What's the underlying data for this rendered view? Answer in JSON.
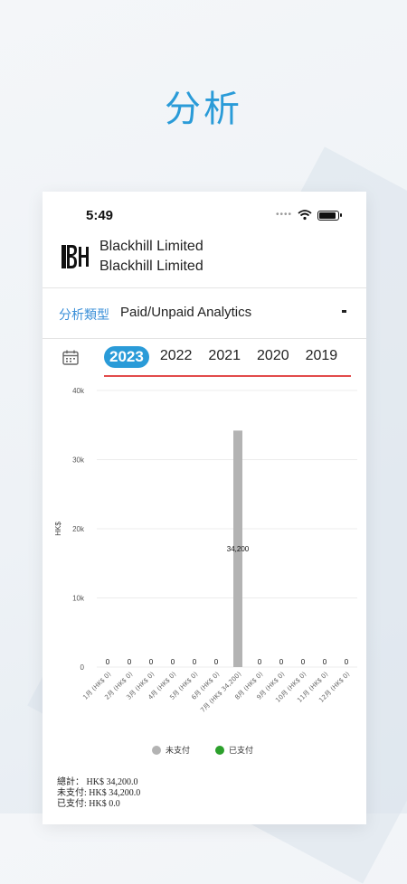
{
  "page": {
    "title": "分析"
  },
  "status_bar": {
    "time": "5:49"
  },
  "company": {
    "name_line1": "Blackhill Limited",
    "name_line2": "Blackhill Limited"
  },
  "analysis": {
    "label": "分析類型",
    "value": "Paid/Unpaid Analytics"
  },
  "years": [
    "2023",
    "2022",
    "2021",
    "2020",
    "2019"
  ],
  "active_year": "2023",
  "colors": {
    "accent": "#2a9bd8",
    "unpaid": "#b3b3b3",
    "paid": "#2ca02c",
    "year_underline": "#e24b4b"
  },
  "chart_data": {
    "type": "bar",
    "ylabel": "HK$",
    "ylim": [
      0,
      40000
    ],
    "yticks": [
      "0",
      "10k",
      "20k",
      "30k",
      "40k"
    ],
    "ytick_values": [
      0,
      10000,
      20000,
      30000,
      40000
    ],
    "categories": [
      "1月 (HK$ 0)",
      "2月 (HK$ 0)",
      "3月 (HK$ 0)",
      "4月 (HK$ 0)",
      "5月 (HK$ 0)",
      "6月 (HK$ 0)",
      "7月 (HK$ 34,200)",
      "8月 (HK$ 0)",
      "9月 (HK$ 0)",
      "10月 (HK$ 0)",
      "11月 (HK$ 0)",
      "12月 (HK$ 0)"
    ],
    "series": [
      {
        "name": "未支付",
        "values": [
          0,
          0,
          0,
          0,
          0,
          0,
          34200,
          0,
          0,
          0,
          0,
          0
        ],
        "labels": [
          "0",
          "0",
          "0",
          "0",
          "0",
          "0",
          "34,200",
          "0",
          "0",
          "0",
          "0",
          "0"
        ]
      },
      {
        "name": "已支付",
        "values": [
          0,
          0,
          0,
          0,
          0,
          0,
          0,
          0,
          0,
          0,
          0,
          0
        ],
        "labels": [
          "0",
          "0",
          "0",
          "0",
          "0",
          "0",
          "0",
          "0",
          "0",
          "0",
          "0",
          "0"
        ]
      }
    ],
    "legend": "bottom",
    "grid": true
  },
  "summary": {
    "total": "總計： HK$ 34,200.0",
    "unpaid": "未支付: HK$ 34,200.0",
    "paid": "已支付: HK$ 0.0"
  }
}
